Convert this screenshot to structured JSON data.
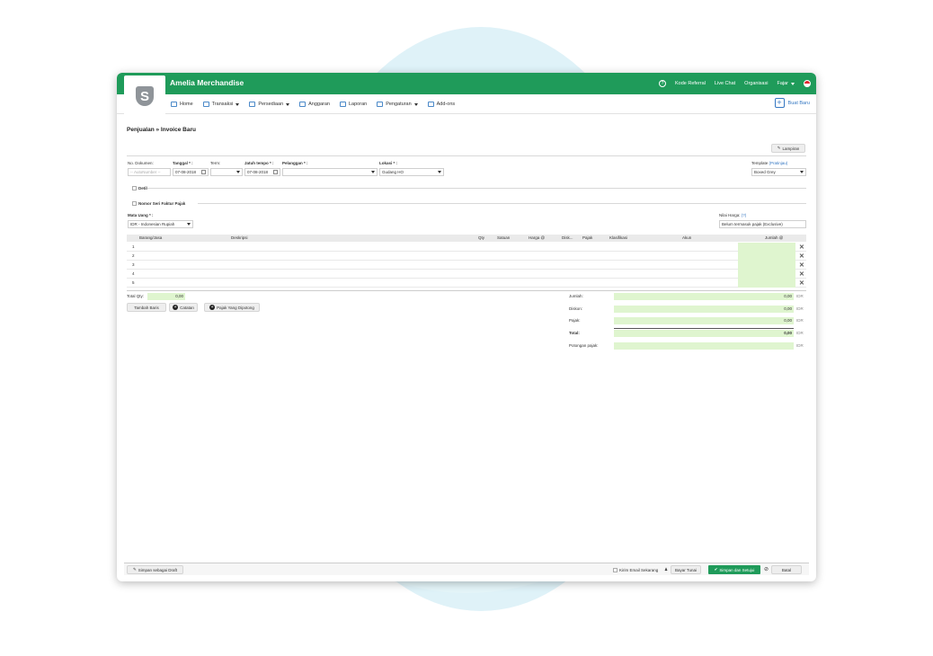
{
  "app": {
    "title": "Amelia Merchandise",
    "logo_letter": "S"
  },
  "topbar": {
    "help": "?",
    "links": [
      "Kode Referral",
      "Live Chat",
      "Organisasi",
      "Fajar"
    ]
  },
  "nav": {
    "items": [
      {
        "label": "Home",
        "dropdown": false
      },
      {
        "label": "Transaksi",
        "dropdown": true
      },
      {
        "label": "Persediaan",
        "dropdown": true
      },
      {
        "label": "Anggaran",
        "dropdown": false
      },
      {
        "label": "Laporan",
        "dropdown": false
      },
      {
        "label": "Pengaturan",
        "dropdown": true
      },
      {
        "label": "Add-ons",
        "dropdown": false
      }
    ],
    "new_label": "Buat Baru"
  },
  "breadcrumb": "Penjualan » Invoice Baru",
  "attach_label": "Lampiran",
  "form": {
    "doc_no_label": "No. Dokumen:",
    "doc_no_placeholder": "-- AutoNumber --",
    "date_label": "Tanggal * :",
    "date_value": "07-08-2018",
    "term_label": "Term:",
    "due_label": "Jatuh tempo * :",
    "due_value": "07-08-2018",
    "customer_label": "Pelanggan * :",
    "location_label": "Lokasi * :",
    "location_value": "Gudang HO",
    "template_label": "Template",
    "template_preview": "(Pratinjau)",
    "template_value": "Boxed Grey",
    "detail_label": "Detil",
    "tax_serial_label": "Nomor Seri Faktur Pajak",
    "currency_label": "Mata Uang * :",
    "currency_value": "IDR - Indonesian Rupiah",
    "price_label": "Nilai Harga:",
    "price_help": "(?)",
    "price_value": "Belum termasuk pajak (Exclusive)"
  },
  "table": {
    "headers": [
      "Barang/Jasa",
      "Deskripsi",
      "Qty",
      "Satuan",
      "Harga @",
      "Disk...",
      "Pajak",
      "Klasifikasi",
      "Akun",
      "Jumlah @"
    ],
    "rows": [
      "1",
      "2",
      "3",
      "4",
      "5"
    ]
  },
  "totals": {
    "qty_label": "Total Qty:",
    "qty_value": "0,00",
    "add_row": "Tambah Baris",
    "note": "Catatan",
    "withheld_tax": "Pajak Yang Dipotong",
    "sum_label": "Jumlah:",
    "discount_label": "Diskon:",
    "tax_label": "Pajak:",
    "total_label": "Total:",
    "tax_cut_label": "Potongan pajak:",
    "sum_value": "0,00",
    "discount_value": "0,00",
    "tax_value": "0,00",
    "total_value": "0,00",
    "currency": "IDR"
  },
  "footer": {
    "draft": "Simpan sebagai Draft",
    "email": "Kirim Email Sekarang",
    "cash": "Bayar Tunai",
    "save": "Simpan dan Setujui",
    "cancel": "Batal"
  }
}
